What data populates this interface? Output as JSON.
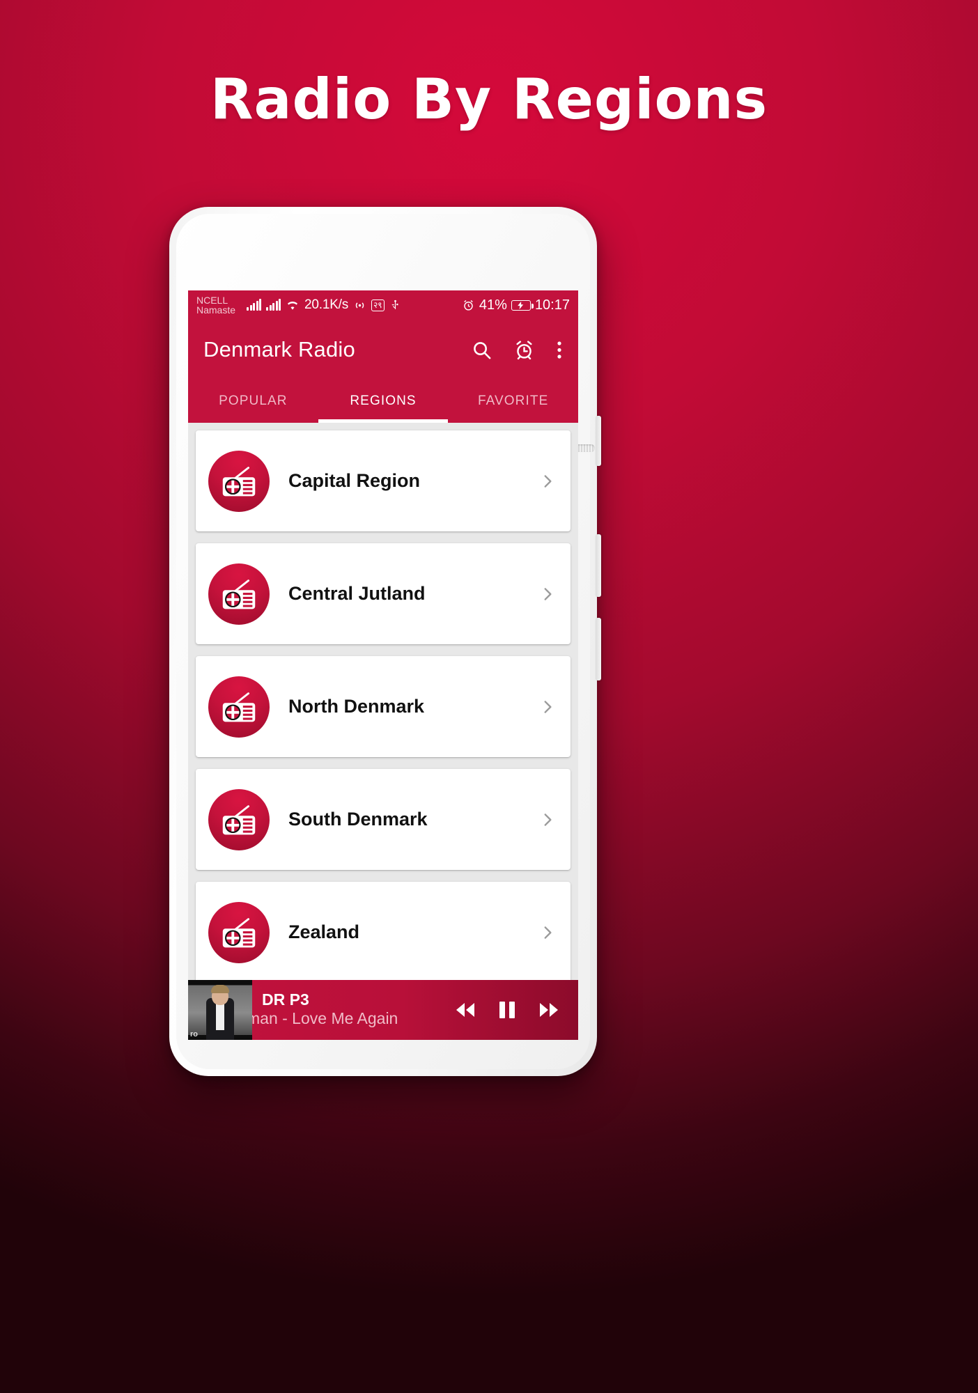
{
  "page": {
    "title": "Radio By Regions"
  },
  "statusbar": {
    "carrier_line1": "NCELL",
    "carrier_line2": "Namaste",
    "network_speed": "20.1K/s",
    "nepali_badge": "२९",
    "battery_percent": "41%",
    "clock": "10:17",
    "icons": [
      "signal-bars-icon",
      "signal-bars-icon",
      "wifi-icon",
      "broadcast-icon",
      "nepali-date-icon",
      "usb-icon",
      "alarm-icon",
      "battery-charging-icon"
    ]
  },
  "appbar": {
    "title": "Denmark Radio",
    "actions": [
      {
        "name": "search-icon",
        "label": "Search"
      },
      {
        "name": "alarm-icon",
        "label": "Sleep timer"
      },
      {
        "name": "overflow-menu-icon",
        "label": "More options"
      }
    ]
  },
  "tabs": [
    {
      "label": "POPULAR",
      "active": false
    },
    {
      "label": "REGIONS",
      "active": true
    },
    {
      "label": "FAVORITE",
      "active": false
    }
  ],
  "regions": [
    {
      "name": "Capital Region"
    },
    {
      "name": "Central Jutland"
    },
    {
      "name": "North Denmark"
    },
    {
      "name": "South Denmark"
    },
    {
      "name": "Zealand"
    }
  ],
  "player": {
    "station": "DR P3",
    "now_playing": "man - Love Me Again",
    "thumb_watermark": "ro",
    "controls": [
      {
        "name": "rewind-button",
        "label": "Rewind"
      },
      {
        "name": "pause-button",
        "label": "Pause"
      },
      {
        "name": "forward-button",
        "label": "Forward"
      }
    ]
  },
  "colors": {
    "brand_red": "#c2123d",
    "background_red": "#c20b36",
    "card_white": "#ffffff",
    "inactive_tab": "#f0b9c6"
  }
}
